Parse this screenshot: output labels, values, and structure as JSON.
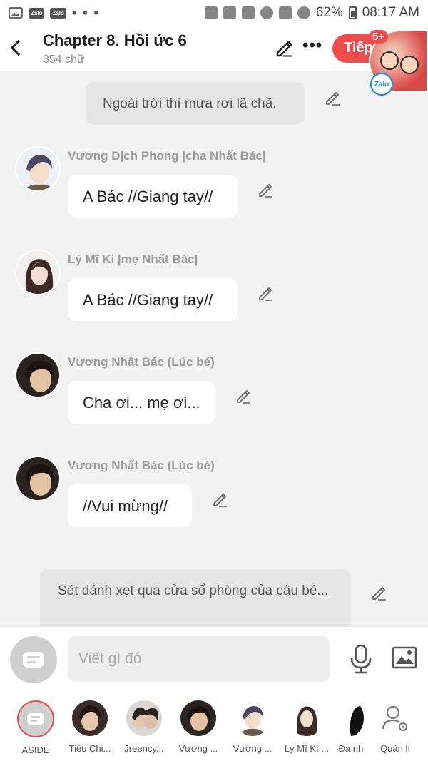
{
  "status_bar": {
    "app_icons": [
      "gallery-icon",
      "zalo-icon",
      "zalo-icon"
    ],
    "zalo_label": "Zalo",
    "more": "• • •",
    "battery_percent": "62%",
    "time": "08:17 AM"
  },
  "header": {
    "title": "Chapter 8. Hồi ức 6",
    "subtitle": "354 chữ",
    "more": "•••",
    "next_label": "Tiếp",
    "chathead_badge": "5+",
    "chathead_zalo": "Zalo"
  },
  "messages": [
    {
      "type": "narration",
      "text": "Ngoài trời thì mưa rơi lã chã."
    },
    {
      "type": "character",
      "name": "Vương Dịch Phong |cha Nhất Bác|",
      "text": "A Bác //Giang tay//"
    },
    {
      "type": "character",
      "name": "Lý Mĩ Kì |mẹ Nhất Bác|",
      "text": "A Bác //Giang tay//"
    },
    {
      "type": "character",
      "name": "Vương Nhất Bác (Lúc bé)",
      "text": "Cha ơi... mẹ ơi..."
    },
    {
      "type": "character",
      "name": "Vương Nhất Bác (Lúc bé)",
      "text": "//Vui mừng//"
    },
    {
      "type": "narration",
      "text": "Sét đánh xẹt qua cửa sổ phòng của cậu bé..."
    }
  ],
  "composer": {
    "placeholder": "Viết gì đó"
  },
  "characters": [
    {
      "label": "ASIDE"
    },
    {
      "label": "Tiêu Chi..."
    },
    {
      "label": "Jreency..."
    },
    {
      "label": "Vương ..."
    },
    {
      "label": "Vương ..."
    },
    {
      "label": "Lý Mĩ Kì ..."
    },
    {
      "label": "Đa nh"
    },
    {
      "label": "Quản lí"
    }
  ],
  "colors": {
    "accent": "#f04a4a",
    "background": "#f2f2f2",
    "bubble": "#ffffff",
    "narration": "#e6e6e6"
  }
}
